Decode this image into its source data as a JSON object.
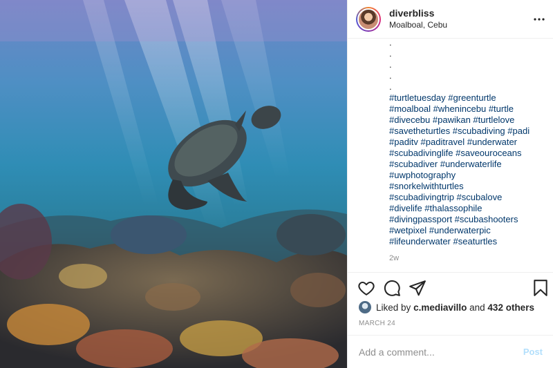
{
  "post": {
    "username": "diverbliss",
    "location": "Moalboal, Cebu",
    "caption_dots": [
      ".",
      ".",
      ".",
      ".",
      "."
    ],
    "hashtags": "#turtletuesday #greenturtle #moalboal #whenincebu #turtle #divecebu #pawikan #turtlelove #savetheturtles #scubadiving #padi #paditv #paditravel #underwater #scubadivinglife #saveouroceans #scubadiver #underwaterlife #uwphotography #snorkelwithturtles #scubadivingtrip #scubalove #divelife #thalassophile #divingpassport #scubashooters #wetpixel #underwaterpic #lifeunderwater #seaturtles",
    "hashtag_lines": [
      "#turtletuesday #greenturtle",
      "#moalboal #whenincebu #turtle",
      "#divecebu #pawikan #turtlelove",
      "#savetheturtles #scubadiving #padi",
      "#paditv #paditravel #underwater",
      "#scubadivinglife #saveouroceans",
      "#scubadiver #underwaterlife",
      "#uwphotography",
      "#snorkelwithturtles",
      "#scubadivingtrip #scubalove",
      "#divelife #thalassophile",
      "#divingpassport #scubashooters",
      "#wetpixel #underwaterpic",
      "#lifeunderwater #seaturtles"
    ],
    "time_ago": "2w",
    "likes_prefix": "Liked by",
    "liked_by_user": "c.mediavillo",
    "likes_and": "and",
    "likes_others": "432 others",
    "date": "MARCH 24"
  },
  "comment": {
    "placeholder": "Add a comment...",
    "post_label": "Post"
  },
  "icons": {
    "more": "more-options-icon",
    "like": "heart-icon",
    "comment": "comment-bubble-icon",
    "share": "paper-plane-icon",
    "save": "bookmark-icon"
  },
  "colors": {
    "hashtag": "#00376b",
    "post_button_disabled": "#b2dffc",
    "muted": "#8e8e8e"
  }
}
